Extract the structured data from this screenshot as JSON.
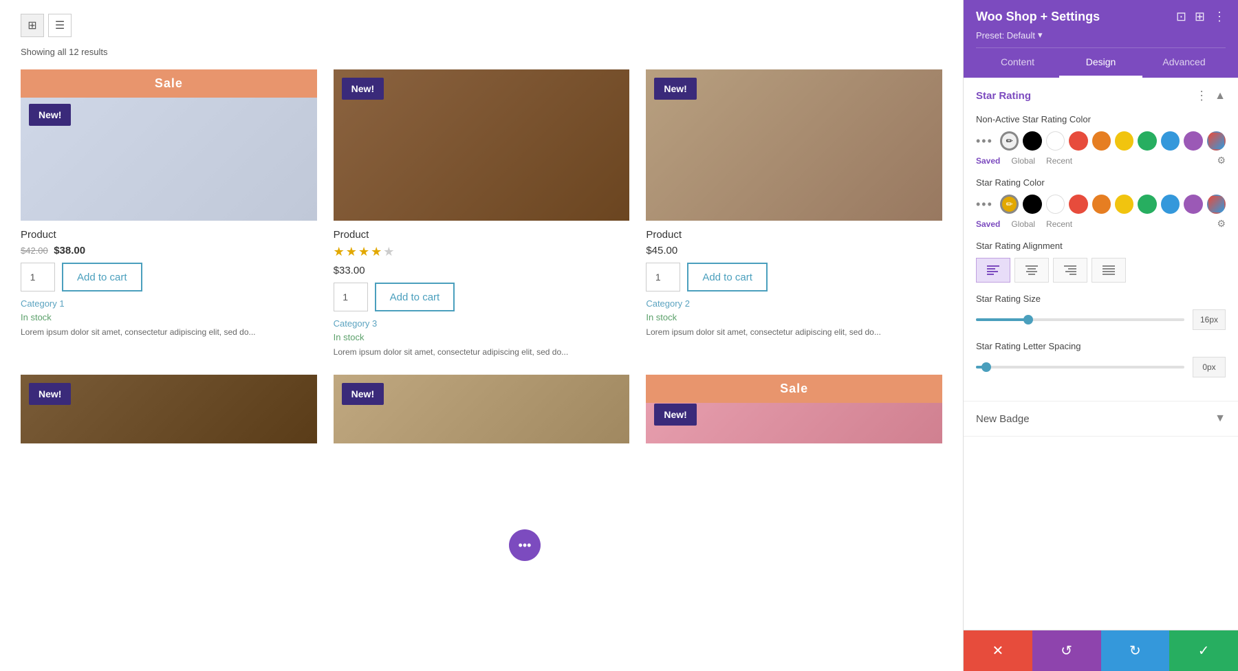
{
  "shop": {
    "results_count": "Showing all 12 results",
    "view_grid_icon": "⊞",
    "view_list_icon": "☰",
    "products": [
      {
        "id": 1,
        "title": "Product",
        "has_sale_banner": true,
        "sale_banner_text": "Sale",
        "has_new_badge": true,
        "new_badge_text": "New!",
        "new_badge_top": true,
        "price_original": "$42.00",
        "price_sale": "$38.00",
        "has_star_rating": false,
        "stars_filled": 0,
        "stars_empty": 0,
        "qty": 1,
        "add_to_cart_label": "Add to cart",
        "category": "Category 1",
        "in_stock_text": "In stock",
        "description": "Lorem ipsum dolor sit amet, consectetur adipiscing elit, sed do...",
        "image_class": "img-photos"
      },
      {
        "id": 2,
        "title": "Product",
        "has_sale_banner": false,
        "sale_banner_text": "",
        "has_new_badge": true,
        "new_badge_text": "New!",
        "new_badge_top": false,
        "price_original": "",
        "price_sale": "",
        "price_regular": "$33.00",
        "has_star_rating": true,
        "stars_filled": 4,
        "stars_empty": 1,
        "qty": 1,
        "add_to_cart_label": "Add to cart",
        "category": "Category 3",
        "in_stock_text": "In stock",
        "description": "Lorem ipsum dolor sit amet, consectetur adipiscing elit, sed do...",
        "image_class": "img-bag"
      },
      {
        "id": 3,
        "title": "Product",
        "has_sale_banner": false,
        "sale_banner_text": "",
        "has_new_badge": true,
        "new_badge_text": "New!",
        "new_badge_top": false,
        "price_original": "",
        "price_sale": "",
        "price_regular": "$45.00",
        "has_star_rating": false,
        "stars_filled": 0,
        "stars_empty": 0,
        "qty": 1,
        "add_to_cart_label": "Add to cart",
        "category": "Category 2",
        "in_stock_text": "In stock",
        "description": "Lorem ipsum dolor sit amet, consectetur adipiscing elit, sed do...",
        "image_class": "img-shoes"
      },
      {
        "id": 4,
        "title": "",
        "has_sale_banner": false,
        "has_new_badge": true,
        "new_badge_text": "New!",
        "image_class": "img-brown1"
      },
      {
        "id": 5,
        "title": "",
        "has_sale_banner": false,
        "has_new_badge": true,
        "new_badge_text": "New!",
        "image_class": "img-bag2"
      },
      {
        "id": 6,
        "title": "",
        "has_sale_banner": true,
        "sale_banner_text": "Sale",
        "has_new_badge": true,
        "new_badge_text": "New!",
        "image_class": "img-pink"
      }
    ]
  },
  "settings": {
    "title": "Woo Shop + Settings",
    "preset_label": "Preset: Default",
    "preset_arrow": "▾",
    "header_icons": [
      "⊡",
      "⊞",
      "⋮"
    ],
    "tabs": [
      {
        "id": "content",
        "label": "Content"
      },
      {
        "id": "design",
        "label": "Design"
      },
      {
        "id": "advanced",
        "label": "Advanced"
      }
    ],
    "active_tab": "design",
    "star_rating_section": {
      "title": "Star Rating",
      "non_active_label": "Non-Active Star Rating Color",
      "active_label": "Star Rating Color",
      "colors": [
        {
          "id": "brush",
          "value": "brush",
          "bg": "#f5f5f5",
          "icon": "✏️"
        },
        {
          "id": "black",
          "value": "#000000",
          "bg": "#000000"
        },
        {
          "id": "white",
          "value": "#ffffff",
          "bg": "#ffffff"
        },
        {
          "id": "red",
          "value": "#e74c3c",
          "bg": "#e74c3c"
        },
        {
          "id": "orange",
          "value": "#e67e22",
          "bg": "#e67e22"
        },
        {
          "id": "yellow",
          "value": "#f1c40f",
          "bg": "#f1c40f"
        },
        {
          "id": "green",
          "value": "#27ae60",
          "bg": "#27ae60"
        },
        {
          "id": "blue",
          "value": "#3498db",
          "bg": "#3498db"
        },
        {
          "id": "purple",
          "value": "#9b59b6",
          "bg": "#9b59b6"
        },
        {
          "id": "gradient",
          "value": "gradient",
          "bg": "linear-gradient(135deg,#e74c3c,#3498db)",
          "icon": "↗"
        }
      ],
      "color_tabs": [
        "Saved",
        "Global",
        "Recent"
      ],
      "active_color_tab": "Saved",
      "alignment_label": "Star Rating Alignment",
      "alignments": [
        "left",
        "center",
        "right",
        "justify"
      ],
      "active_alignment": "left",
      "size_label": "Star Rating Size",
      "size_value": "16px",
      "size_slider_pct": 25,
      "letter_spacing_label": "Star Rating Letter Spacing",
      "letter_spacing_value": "0px",
      "letter_spacing_slider_pct": 5
    },
    "new_badge_section": {
      "title": "New Badge",
      "collapsed": true
    },
    "toolbar": {
      "cancel_icon": "✕",
      "undo_icon": "↺",
      "redo_icon": "↻",
      "save_icon": "✓"
    }
  },
  "floating": {
    "dots_icon": "•••"
  }
}
